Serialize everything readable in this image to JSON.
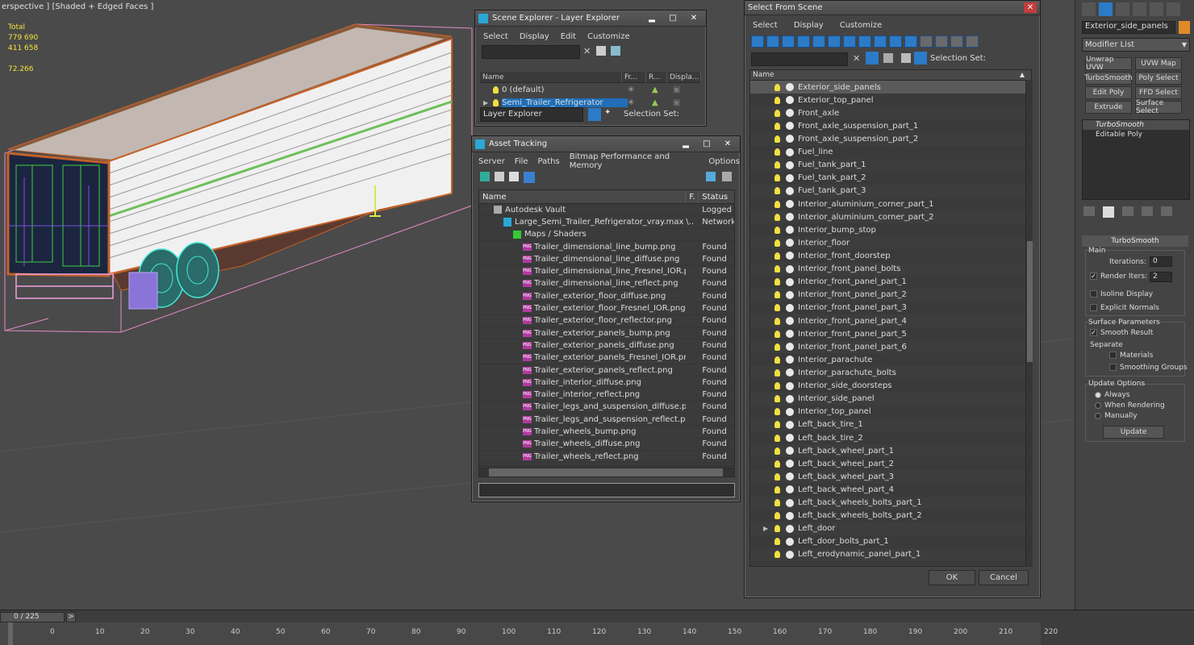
{
  "viewport": {
    "label": "erspective ] [Shaded + Edged Faces ]",
    "stats": {
      "total_label": "Total",
      "polys": "779 690",
      "verts": "411 658",
      "fps": "72.266"
    }
  },
  "scene_explorer": {
    "title": "Scene Explorer - Layer Explorer",
    "menu": [
      "Select",
      "Display",
      "Edit",
      "Customize"
    ],
    "columns": [
      "Name",
      "Fr...",
      "R...",
      "Displa..."
    ],
    "layers": [
      {
        "name": "0 (default)",
        "selected": false
      },
      {
        "name": "Semi_Trailer_Refrigerator",
        "selected": true
      }
    ],
    "mode": "Layer Explorer",
    "selection_set_label": "Selection Set:"
  },
  "asset_tracking": {
    "title": "Asset Tracking",
    "menu": [
      "Server",
      "File",
      "Paths",
      "Bitmap Performance and Memory",
      "Options"
    ],
    "columns": [
      "Name",
      "F.",
      "Status"
    ],
    "rows": [
      {
        "name": "Autodesk Vault",
        "f": "",
        "status": "Logged",
        "indent": 0,
        "kind": "vault"
      },
      {
        "name": "Large_Semi_Trailer_Refrigerator_vray.max",
        "f": "\\..",
        "status": "Network",
        "indent": 1,
        "kind": "max"
      },
      {
        "name": "Maps / Shaders",
        "f": "",
        "status": "",
        "indent": 2,
        "kind": "maps"
      },
      {
        "name": "Trailer_dimensional_line_bump.png",
        "f": "",
        "status": "Found",
        "indent": 3,
        "kind": "png"
      },
      {
        "name": "Trailer_dimensional_line_diffuse.png",
        "f": "",
        "status": "Found",
        "indent": 3,
        "kind": "png"
      },
      {
        "name": "Trailer_dimensional_line_Fresnel_IOR.png",
        "f": "",
        "status": "Found",
        "indent": 3,
        "kind": "png"
      },
      {
        "name": "Trailer_dimensional_line_reflect.png",
        "f": "",
        "status": "Found",
        "indent": 3,
        "kind": "png"
      },
      {
        "name": "Trailer_exterior_floor_diffuse.png",
        "f": "",
        "status": "Found",
        "indent": 3,
        "kind": "png"
      },
      {
        "name": "Trailer_exterior_floor_Fresnel_IOR.png",
        "f": "",
        "status": "Found",
        "indent": 3,
        "kind": "png"
      },
      {
        "name": "Trailer_exterior_floor_reflector.png",
        "f": "",
        "status": "Found",
        "indent": 3,
        "kind": "png"
      },
      {
        "name": "Trailer_exterior_panels_bump.png",
        "f": "",
        "status": "Found",
        "indent": 3,
        "kind": "png"
      },
      {
        "name": "Trailer_exterior_panels_diffuse.png",
        "f": "",
        "status": "Found",
        "indent": 3,
        "kind": "png"
      },
      {
        "name": "Trailer_exterior_panels_Fresnel_IOR.png",
        "f": "",
        "status": "Found",
        "indent": 3,
        "kind": "png"
      },
      {
        "name": "Trailer_exterior_panels_reflect.png",
        "f": "",
        "status": "Found",
        "indent": 3,
        "kind": "png"
      },
      {
        "name": "Trailer_interior_diffuse.png",
        "f": "",
        "status": "Found",
        "indent": 3,
        "kind": "png"
      },
      {
        "name": "Trailer_interior_reflect.png",
        "f": "",
        "status": "Found",
        "indent": 3,
        "kind": "png"
      },
      {
        "name": "Trailer_legs_and_suspension_diffuse.png",
        "f": "",
        "status": "Found",
        "indent": 3,
        "kind": "png"
      },
      {
        "name": "Trailer_legs_and_suspension_reflect.png",
        "f": "",
        "status": "Found",
        "indent": 3,
        "kind": "png"
      },
      {
        "name": "Trailer_wheels_bump.png",
        "f": "",
        "status": "Found",
        "indent": 3,
        "kind": "png"
      },
      {
        "name": "Trailer_wheels_diffuse.png",
        "f": "",
        "status": "Found",
        "indent": 3,
        "kind": "png"
      },
      {
        "name": "Trailer_wheels_reflect.png",
        "f": "",
        "status": "Found",
        "indent": 3,
        "kind": "png"
      }
    ]
  },
  "select_from_scene": {
    "title": "Select From Scene",
    "menu": [
      "Select",
      "Display",
      "Customize"
    ],
    "selection_set_label": "Selection Set:",
    "column_name": "Name",
    "objects": [
      {
        "name": "Exterior_side_panels",
        "selected": true
      },
      {
        "name": "Exterior_top_panel"
      },
      {
        "name": "Front_axle"
      },
      {
        "name": "Front_axle_suspension_part_1"
      },
      {
        "name": "Front_axle_suspension_part_2"
      },
      {
        "name": "Fuel_line"
      },
      {
        "name": "Fuel_tank_part_1"
      },
      {
        "name": "Fuel_tank_part_2"
      },
      {
        "name": "Fuel_tank_part_3"
      },
      {
        "name": "Interior_aluminium_corner_part_1"
      },
      {
        "name": "Interior_aluminium_corner_part_2"
      },
      {
        "name": "Interior_bump_stop"
      },
      {
        "name": "Interior_floor"
      },
      {
        "name": "Interior_front_doorstep"
      },
      {
        "name": "Interior_front_panel_bolts"
      },
      {
        "name": "Interior_front_panel_part_1"
      },
      {
        "name": "Interior_front_panel_part_2"
      },
      {
        "name": "Interior_front_panel_part_3"
      },
      {
        "name": "Interior_front_panel_part_4"
      },
      {
        "name": "Interior_front_panel_part_5"
      },
      {
        "name": "Interior_front_panel_part_6"
      },
      {
        "name": "Interior_parachute"
      },
      {
        "name": "Interior_parachute_bolts"
      },
      {
        "name": "Interior_side_doorsteps"
      },
      {
        "name": "Interior_side_panel"
      },
      {
        "name": "Interior_top_panel"
      },
      {
        "name": "Left_back_tire_1"
      },
      {
        "name": "Left_back_tire_2"
      },
      {
        "name": "Left_back_wheel_part_1"
      },
      {
        "name": "Left_back_wheel_part_2"
      },
      {
        "name": "Left_back_wheel_part_3"
      },
      {
        "name": "Left_back_wheel_part_4"
      },
      {
        "name": "Left_back_wheels_bolts_part_1"
      },
      {
        "name": "Left_back_wheels_bolts_part_2"
      },
      {
        "name": "Left_door",
        "expandable": true
      },
      {
        "name": "Left_door_bolts_part_1"
      },
      {
        "name": "Left_erodynamic_panel_part_1"
      }
    ],
    "ok_label": "OK",
    "cancel_label": "Cancel"
  },
  "command_panel": {
    "object_name": "Exterior_side_panels",
    "object_color": "#e08a2a",
    "modifier_list_label": "Modifier List",
    "modifier_buttons": [
      "Unwrap UVW",
      "UVW Map",
      "TurboSmooth",
      "Poly Select",
      "Edit Poly",
      "FFD Select",
      "Extrude",
      "Surface Select"
    ],
    "stack": [
      "TurboSmooth",
      "Editable Poly"
    ],
    "rollout_title": "TurboSmooth",
    "main_label": "Main",
    "iterations_label": "Iterations:",
    "iterations_value": "0",
    "render_iters_label": "Render Iters:",
    "render_iters_value": "2",
    "isoline_label": "Isoline Display",
    "explicit_normals_label": "Explicit Normals",
    "surface_params_label": "Surface Parameters",
    "smooth_result_label": "Smooth Result",
    "separate_label": "Separate",
    "materials_label": "Materials",
    "smoothing_groups_label": "Smoothing Groups",
    "update_options_label": "Update Options",
    "always_label": "Always",
    "when_rendering_label": "When Rendering",
    "manually_label": "Manually",
    "update_label": "Update"
  },
  "timeline": {
    "frame_label": "0 / 225",
    "next_label": ">",
    "ticks": [
      "0",
      "10",
      "20",
      "30",
      "40",
      "50",
      "60",
      "70",
      "80",
      "90",
      "100",
      "110",
      "120",
      "130",
      "140",
      "150",
      "160",
      "170",
      "180",
      "190",
      "200",
      "210",
      "220"
    ]
  }
}
